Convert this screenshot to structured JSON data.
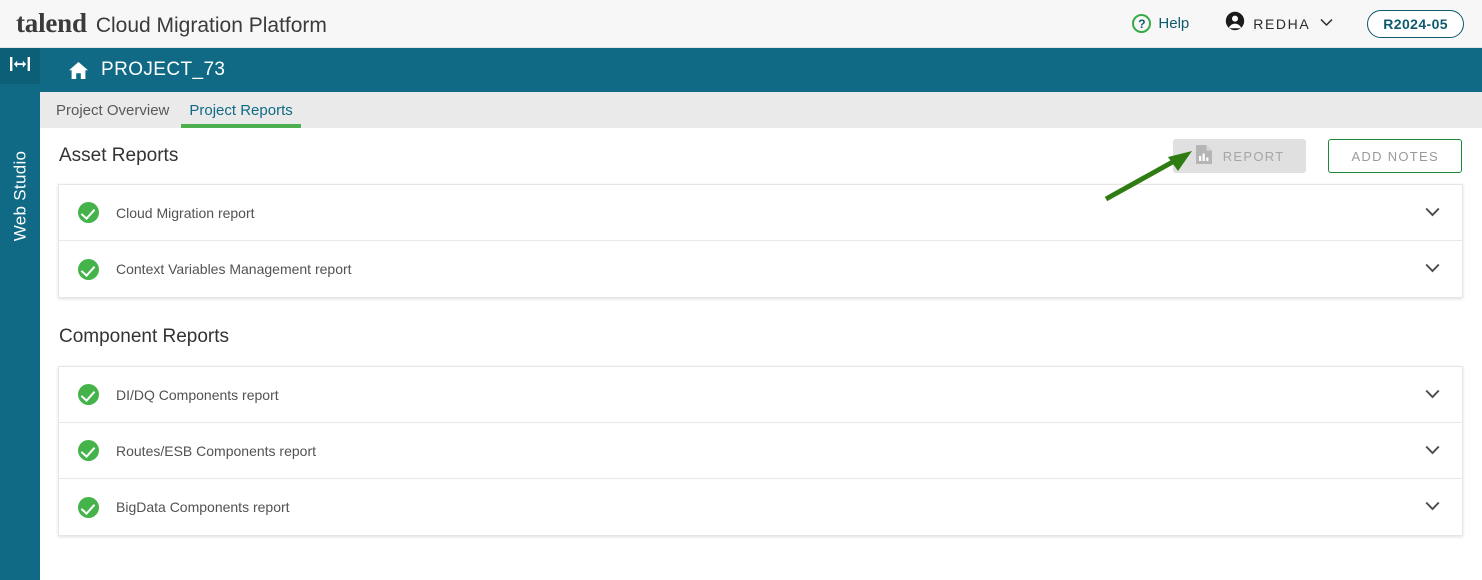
{
  "appbar": {
    "logo": "talend",
    "product": "Cloud Migration Platform",
    "help_label": "Help",
    "help_icon": "question-circle-icon",
    "help_glyph": "?",
    "user_name": "REDHA",
    "user_icon": "account-circle-icon",
    "caret_icon": "chevron-down-icon",
    "caret_glyph": "⌄",
    "release": "R2024-05",
    "accent_green": "#3aa94a",
    "accent_teal": "#0e5a6e"
  },
  "sidebar": {
    "toggle_icon": "expand-collapse-horizontal-icon",
    "label": "Web Studio",
    "background": "#106a85"
  },
  "project": {
    "home_icon": "home-icon",
    "name": "PROJECT_73",
    "background": "#106a85"
  },
  "tabs": [
    {
      "label": "Project Overview",
      "active": false
    },
    {
      "label": "Project Reports",
      "active": true
    }
  ],
  "sections": [
    {
      "title": "Asset Reports",
      "rows": [
        {
          "status_icon": "check-circle-icon",
          "label": "Cloud Migration report",
          "expand_icon": "chevron-down-icon"
        },
        {
          "status_icon": "check-circle-icon",
          "label": "Context Variables Management report",
          "expand_icon": "chevron-down-icon"
        }
      ]
    },
    {
      "title": "Component Reports",
      "rows": [
        {
          "status_icon": "check-circle-icon",
          "label": "DI/DQ Components report",
          "expand_icon": "chevron-down-icon"
        },
        {
          "status_icon": "check-circle-icon",
          "label": "Routes/ESB Components report",
          "expand_icon": "chevron-down-icon"
        },
        {
          "status_icon": "check-circle-icon",
          "label": "BigData Components report",
          "expand_icon": "chevron-down-icon"
        }
      ]
    }
  ],
  "actions": {
    "report_label": "REPORT",
    "report_icon": "report-document-icon",
    "report_disabled": true,
    "notes_label": "ADD NOTES",
    "notes_border_color": "#1a8a39"
  },
  "annotation": {
    "type": "arrow",
    "color": "#2f7d12",
    "points_to": "report-button"
  }
}
